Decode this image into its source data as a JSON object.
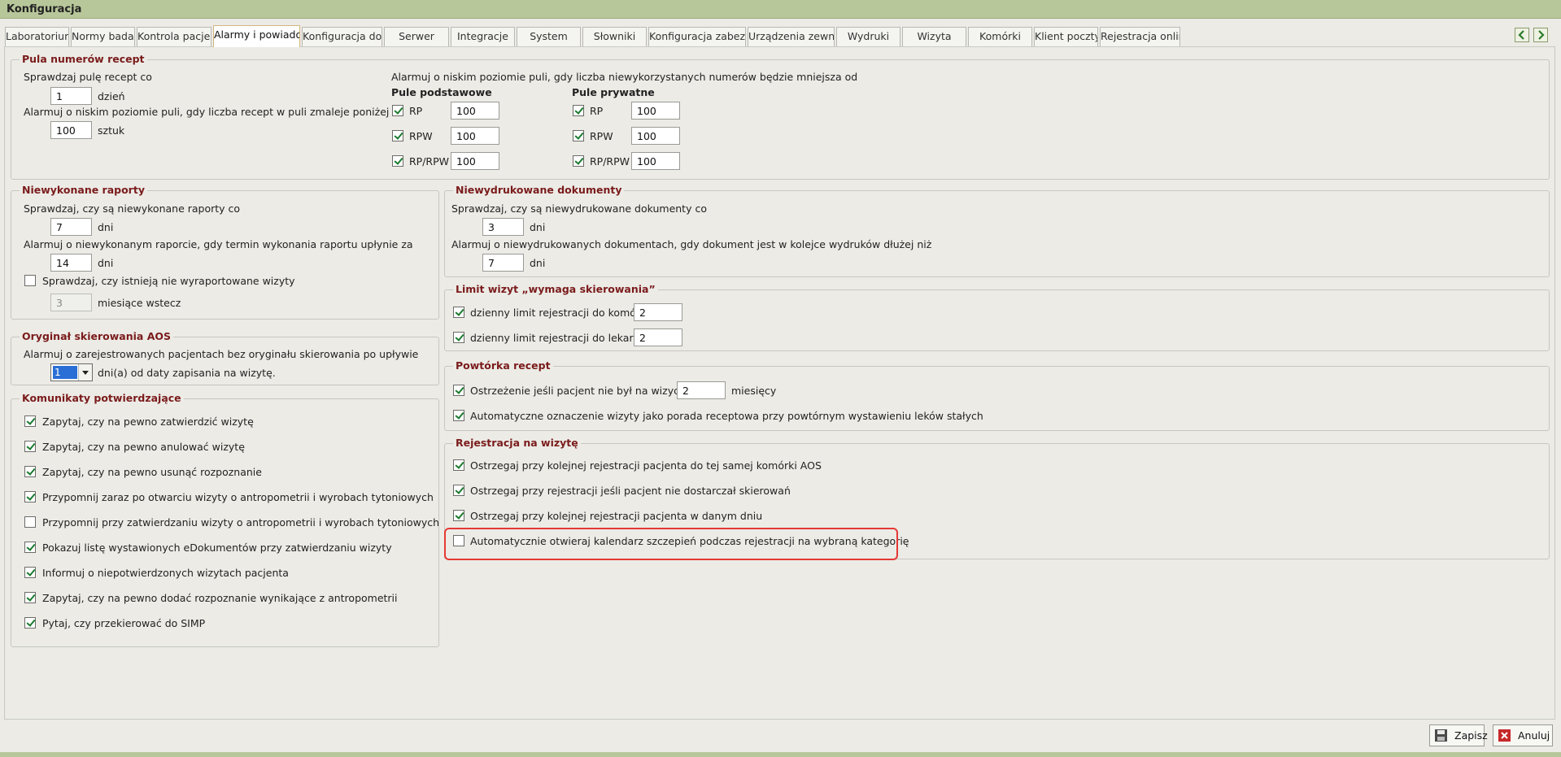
{
  "window": {
    "title": "Konfiguracja"
  },
  "tabs": [
    "Laboratorium",
    "Normy badań",
    "Kontrola pacjentów",
    "Alarmy i powiadomienia",
    "Konfiguracja dostępu",
    "Serwer",
    "Integracje",
    "System",
    "Słowniki",
    "Konfiguracja zabezpieczeń",
    "Urządzenia zewnętrzne",
    "Wydruki",
    "Wizyta",
    "Komórki",
    "Klient poczty",
    "Rejestracja online"
  ],
  "active_tab": "Alarmy i powiadomienia",
  "pula": {
    "legend": "Pula numerów recept",
    "check_label": "Sprawdzaj pulę recept co",
    "check_value": "1",
    "check_unit": "dzień",
    "alarm_label": "Alarmuj o niskim poziomie puli, gdy liczba recept w puli zmaleje poniżej",
    "alarm_value": "100",
    "alarm_unit": "sztuk",
    "pool_label": "Alarmuj o niskim poziomie puli, gdy liczba niewykorzystanych numerów będzie mniejsza od",
    "basic_heading": "Pule podstawowe",
    "private_heading": "Pule prywatne",
    "basic": [
      {
        "label": "RP",
        "value": "100",
        "checked": true
      },
      {
        "label": "RPW",
        "value": "100",
        "checked": true
      },
      {
        "label": "RP/RPW",
        "value": "100",
        "checked": true
      }
    ],
    "private": [
      {
        "label": "RP",
        "value": "100",
        "checked": true
      },
      {
        "label": "RPW",
        "value": "100",
        "checked": true
      },
      {
        "label": "RP/RPW",
        "value": "100",
        "checked": true
      }
    ]
  },
  "raporty": {
    "legend": "Niewykonane raporty",
    "check_label": "Sprawdzaj, czy są niewykonane raporty co",
    "check_value": "7",
    "check_unit": "dni",
    "alarm_label": "Alarmuj o niewykonanym raporcie, gdy termin wykonania raportu upłynie za",
    "alarm_value": "14",
    "alarm_unit": "dni",
    "visits_label": "Sprawdzaj, czy istnieją nie wyraportowane wizyty",
    "visits_checked": false,
    "months_value": "3",
    "months_unit": "miesiące wstecz"
  },
  "dokumenty": {
    "legend": "Niewydrukowane dokumenty",
    "check_label": "Sprawdzaj, czy są niewydrukowane dokumenty co",
    "check_value": "3",
    "check_unit": "dni",
    "alarm_label": "Alarmuj o niewydrukowanych dokumentach, gdy dokument jest w kolejce wydruków dłużej niż",
    "alarm_value": "7",
    "alarm_unit": "dni"
  },
  "limit": {
    "legend": "Limit wizyt „wymaga skierowania”",
    "items": [
      {
        "label": "dzienny limit rejestracji do komórki",
        "value": "2",
        "checked": true
      },
      {
        "label": "dzienny limit rejestracji do lekarza",
        "value": "2",
        "checked": true
      }
    ]
  },
  "oryginal": {
    "legend": "Oryginał skierowania AOS",
    "label": "Alarmuj o zarejestrowanych pacjentach bez oryginału skierowania po upływie",
    "value": "1",
    "unit": "dni(a) od daty zapisania na wizytę."
  },
  "powtorka": {
    "legend": "Powtórka recept",
    "warn_label": "Ostrzeżenie jeśli pacjent nie był na wizycie od",
    "warn_value": "2",
    "warn_unit": "miesięcy",
    "warn_checked": true,
    "auto_label": "Automatyczne oznaczenie wizyty jako porada receptowa przy powtórnym wystawieniu leków stałych",
    "auto_checked": true
  },
  "komunikaty": {
    "legend": "Komunikaty potwierdzające",
    "items": [
      {
        "label": "Zapytaj, czy na pewno zatwierdzić wizytę",
        "checked": true
      },
      {
        "label": "Zapytaj, czy na pewno anulować wizytę",
        "checked": true
      },
      {
        "label": "Zapytaj, czy na pewno usunąć rozpoznanie",
        "checked": true
      },
      {
        "label": "Przypomnij zaraz po otwarciu wizyty o antropometrii i wyrobach tytoniowych",
        "checked": true
      },
      {
        "label": "Przypomnij przy zatwierdzaniu wizyty o antropometrii i wyrobach tytoniowych",
        "checked": false
      },
      {
        "label": "Pokazuj listę wystawionych eDokumentów przy zatwierdzaniu wizyty",
        "checked": true
      },
      {
        "label": "Informuj o niepotwierdzonych wizytach pacjenta",
        "checked": true
      },
      {
        "label": "Zapytaj, czy na pewno dodać rozpoznanie wynikające z antropometrii",
        "checked": true
      },
      {
        "label": "Pytaj, czy przekierować do SIMP",
        "checked": true
      }
    ]
  },
  "rejestracja": {
    "legend": "Rejestracja na wizytę",
    "items": [
      {
        "label": "Ostrzegaj przy kolejnej rejestracji pacjenta do tej samej komórki AOS",
        "checked": true
      },
      {
        "label": "Ostrzegaj przy rejestracji jeśli pacjent nie dostarczał skierowań",
        "checked": true
      },
      {
        "label": "Ostrzegaj przy kolejnej rejestracji pacjenta w danym dniu",
        "checked": true
      },
      {
        "label": "Automatycznie otwieraj kalendarz szczepień podczas rejestracji na wybraną kategorię",
        "checked": false
      }
    ]
  },
  "footer": {
    "save": "Zapisz",
    "cancel": "Anuluj"
  },
  "colors": {
    "legend": "#7a1b1b",
    "titlebar": "#b8c79a",
    "highlight": "#e53935",
    "check": "#1a7a2e"
  }
}
